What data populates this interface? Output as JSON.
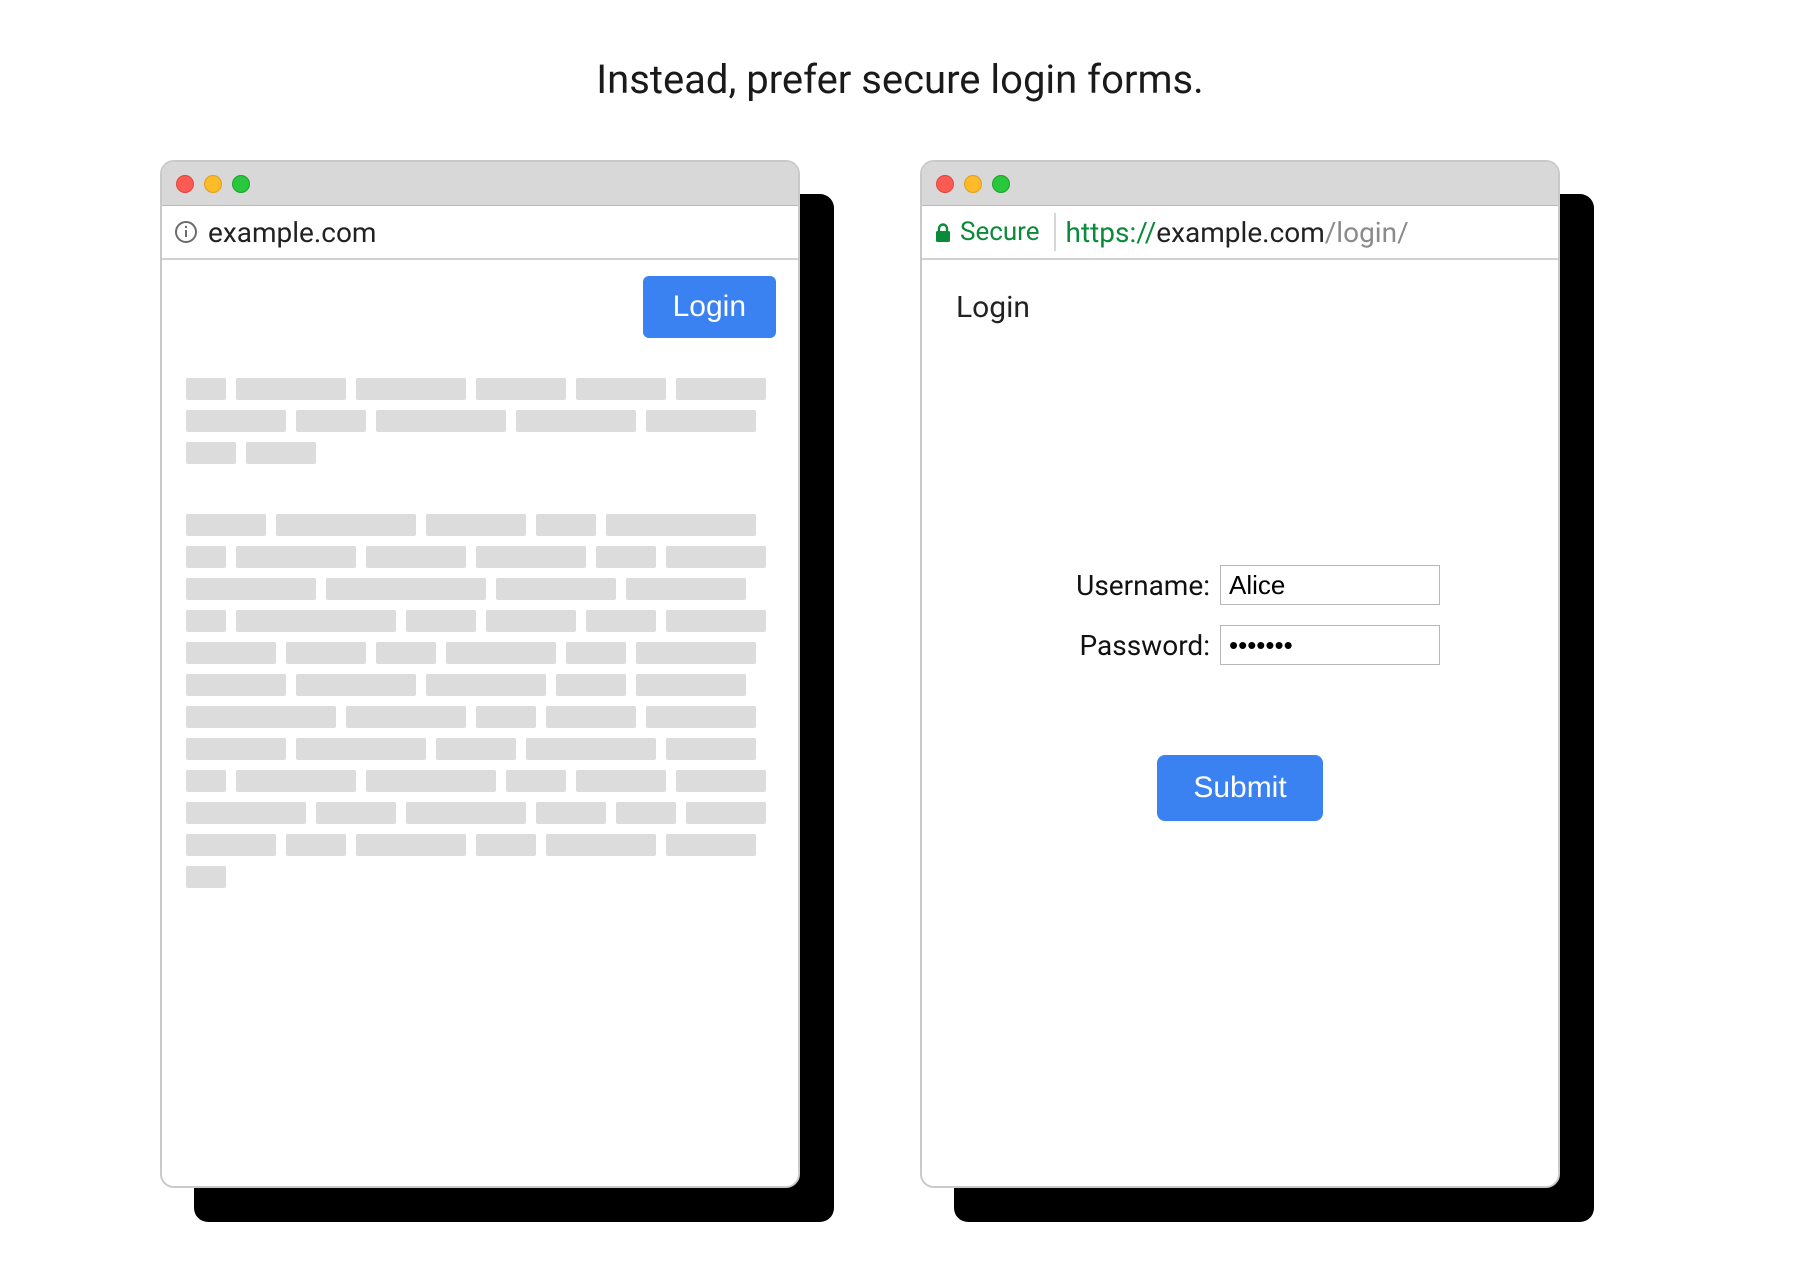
{
  "caption": "Instead, prefer secure login forms.",
  "left_window": {
    "address": "example.com",
    "login_button": "Login"
  },
  "right_window": {
    "secure_label": "Secure",
    "url_prefix": "https://",
    "url_domain": "example.com",
    "url_path": "/login/",
    "title": "Login",
    "username_label": "Username:",
    "username_value": "Alice",
    "password_label": "Password:",
    "password_value": "•••••••",
    "submit_label": "Submit"
  }
}
